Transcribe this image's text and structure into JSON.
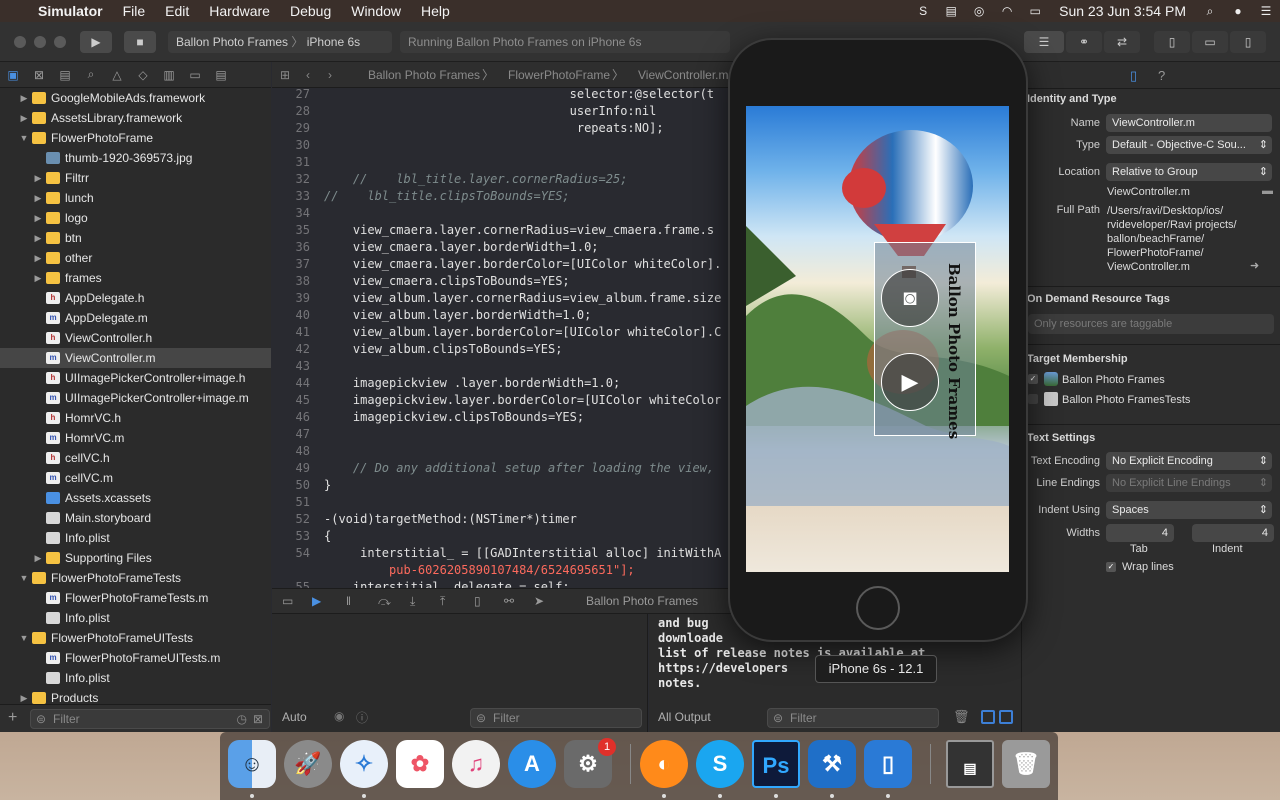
{
  "menubar": {
    "apple": "",
    "app": "Simulator",
    "items": [
      "File",
      "Edit",
      "Hardware",
      "Debug",
      "Window",
      "Help"
    ],
    "clock": "Sun 23 Jun  3:54 PM"
  },
  "toolbar": {
    "scheme_target": "Ballon Photo Frames",
    "scheme_device": "iPhone 6s",
    "activity": "Running Ballon Photo Frames on iPhone 6s"
  },
  "navigator": {
    "items": [
      {
        "label": "GoogleMobileAds.framework",
        "indent": 0,
        "type": "folder",
        "disc": "▶"
      },
      {
        "label": "AssetsLibrary.framework",
        "indent": 0,
        "type": "folder",
        "disc": "▶"
      },
      {
        "label": "FlowerPhotoFrame",
        "indent": 0,
        "type": "folder",
        "disc": "▼"
      },
      {
        "label": "thumb-1920-369573.jpg",
        "indent": 1,
        "type": "img",
        "disc": ""
      },
      {
        "label": "Filtrr",
        "indent": 1,
        "type": "folder",
        "disc": "▶"
      },
      {
        "label": "lunch",
        "indent": 1,
        "type": "folder",
        "disc": "▶"
      },
      {
        "label": "logo",
        "indent": 1,
        "type": "folder",
        "disc": "▶"
      },
      {
        "label": "btn",
        "indent": 1,
        "type": "folder",
        "disc": "▶"
      },
      {
        "label": "other",
        "indent": 1,
        "type": "folder",
        "disc": "▶"
      },
      {
        "label": "frames",
        "indent": 1,
        "type": "folder",
        "disc": "▶"
      },
      {
        "label": "AppDelegate.h",
        "indent": 1,
        "type": "h",
        "disc": ""
      },
      {
        "label": "AppDelegate.m",
        "indent": 1,
        "type": "m",
        "disc": ""
      },
      {
        "label": "ViewController.h",
        "indent": 1,
        "type": "h",
        "disc": ""
      },
      {
        "label": "ViewController.m",
        "indent": 1,
        "type": "m",
        "disc": "",
        "selected": true
      },
      {
        "label": "UIImagePickerController+image.h",
        "indent": 1,
        "type": "h",
        "disc": ""
      },
      {
        "label": "UIImagePickerController+image.m",
        "indent": 1,
        "type": "m",
        "disc": ""
      },
      {
        "label": "HomrVC.h",
        "indent": 1,
        "type": "h",
        "disc": ""
      },
      {
        "label": "HomrVC.m",
        "indent": 1,
        "type": "m",
        "disc": ""
      },
      {
        "label": "cellVC.h",
        "indent": 1,
        "type": "h",
        "disc": ""
      },
      {
        "label": "cellVC.m",
        "indent": 1,
        "type": "m",
        "disc": ""
      },
      {
        "label": "Assets.xcassets",
        "indent": 1,
        "type": "xc",
        "disc": ""
      },
      {
        "label": "Main.storyboard",
        "indent": 1,
        "type": "doc",
        "disc": ""
      },
      {
        "label": "Info.plist",
        "indent": 1,
        "type": "doc",
        "disc": ""
      },
      {
        "label": "Supporting Files",
        "indent": 1,
        "type": "folder",
        "disc": "▶"
      },
      {
        "label": "FlowerPhotoFrameTests",
        "indent": 0,
        "type": "folder",
        "disc": "▼"
      },
      {
        "label": "FlowerPhotoFrameTests.m",
        "indent": 1,
        "type": "m",
        "disc": ""
      },
      {
        "label": "Info.plist",
        "indent": 1,
        "type": "doc",
        "disc": ""
      },
      {
        "label": "FlowerPhotoFrameUITests",
        "indent": 0,
        "type": "folder",
        "disc": "▼"
      },
      {
        "label": "FlowerPhotoFrameUITests.m",
        "indent": 1,
        "type": "m",
        "disc": ""
      },
      {
        "label": "Info.plist",
        "indent": 1,
        "type": "doc",
        "disc": ""
      },
      {
        "label": "Products",
        "indent": 0,
        "type": "folder",
        "disc": "▶"
      }
    ],
    "filter_placeholder": "Filter"
  },
  "jumpbar": {
    "project": "Ballon Photo Frames",
    "group": "FlowerPhotoFrame",
    "file": "ViewController.m"
  },
  "code": [
    {
      "n": "27",
      "html": "                                  selector:@selector(t"
    },
    {
      "n": "28",
      "html": "                                  userInfo:nil"
    },
    {
      "n": "29",
      "html": "                                   repeats:NO];"
    },
    {
      "n": "30",
      "html": ""
    },
    {
      "n": "31",
      "html": ""
    },
    {
      "n": "32",
      "html": "    //    lbl_title.layer.cornerRadius=25;"
    },
    {
      "n": "33",
      "html": "//    lbl_title.clipsToBounds=YES;"
    },
    {
      "n": "34",
      "html": ""
    },
    {
      "n": "35",
      "html": "    view_cmaera.layer.cornerRadius=view_cmaera.frame.s"
    },
    {
      "n": "36",
      "html": "    view_cmaera.layer.borderWidth=1.0;"
    },
    {
      "n": "37",
      "html": "    view_cmaera.layer.borderColor=[UIColor whiteColor]."
    },
    {
      "n": "38",
      "html": "    view_cmaera.clipsToBounds=YES;"
    },
    {
      "n": "39",
      "html": "    view_album.layer.cornerRadius=view_album.frame.size"
    },
    {
      "n": "40",
      "html": "    view_album.layer.borderWidth=1.0;"
    },
    {
      "n": "41",
      "html": "    view_album.layer.borderColor=[UIColor whiteColor].C"
    },
    {
      "n": "42",
      "html": "    view_album.clipsToBounds=YES;"
    },
    {
      "n": "43",
      "html": ""
    },
    {
      "n": "44",
      "html": "    imagepickview .layer.borderWidth=1.0;"
    },
    {
      "n": "45",
      "html": "    imagepickview.layer.borderColor=[UIColor whiteColor"
    },
    {
      "n": "46",
      "html": "    imagepickview.clipsToBounds=YES;"
    },
    {
      "n": "47",
      "html": ""
    },
    {
      "n": "48",
      "html": ""
    },
    {
      "n": "49",
      "html": "    // Do any additional setup after loading the view,"
    },
    {
      "n": "50",
      "html": "}"
    },
    {
      "n": "51",
      "html": ""
    },
    {
      "n": "52",
      "html": "-(void)targetMethod:(NSTimer*)timer"
    },
    {
      "n": "53",
      "html": "{"
    },
    {
      "n": "54",
      "html": "     interstitial_ = [[GADInterstitial alloc] initWithA"
    },
    {
      "n": "",
      "html": "         pub-6026205890107484/6524695651\"];"
    },
    {
      "n": "55",
      "html": "    interstitial_.delegate = self;"
    }
  ],
  "debug": {
    "target": "Ballon Photo Frames",
    "auto": "Auto",
    "filter_placeholder": "Filter",
    "all_output": "All Output",
    "console_text": "and bug\ndownloade\nlist of release notes is available at\nhttps://developers\nnotes."
  },
  "tooltip": "iPhone 6s - 12.1",
  "app_screen": {
    "title": "Ballon Photo Frames"
  },
  "inspector": {
    "identity_header": "Identity and Type",
    "name_label": "Name",
    "name_value": "ViewController.m",
    "type_label": "Type",
    "type_value": "Default - Objective-C Sou...",
    "location_label": "Location",
    "location_value": "Relative to Group",
    "location_file": "ViewController.m",
    "fullpath_label": "Full Path",
    "fullpath_lines": [
      "/Users/ravi/Desktop/ios/",
      "rvideveloper/Ravi projects/",
      "ballon/beachFrame/",
      "FlowerPhotoFrame/",
      "ViewController.m"
    ],
    "odr_header": "On Demand Resource Tags",
    "odr_placeholder": "Only resources are taggable",
    "target_header": "Target Membership",
    "targets": [
      "Ballon Photo Frames",
      "Ballon Photo FramesTests"
    ],
    "text_header": "Text Settings",
    "encoding_label": "Text Encoding",
    "encoding_value": "No Explicit Encoding",
    "endings_label": "Line Endings",
    "endings_value": "No Explicit Line Endings",
    "indent_label": "Indent Using",
    "indent_value": "Spaces",
    "widths_label": "Widths",
    "tab_value": "4",
    "indent_width_value": "4",
    "tab_label": "Tab",
    "indent_sub_label": "Indent",
    "wrap_label": "Wrap lines"
  },
  "dock": {
    "apps": [
      "Finder",
      "Launchpad",
      "Safari",
      "Photos",
      "iTunes",
      "App Store",
      "System Preferences",
      "Firefox",
      "Skype",
      "Photoshop",
      "Xcode",
      "Simulator",
      "Screenshot",
      "Trash"
    ],
    "badge": "1"
  }
}
